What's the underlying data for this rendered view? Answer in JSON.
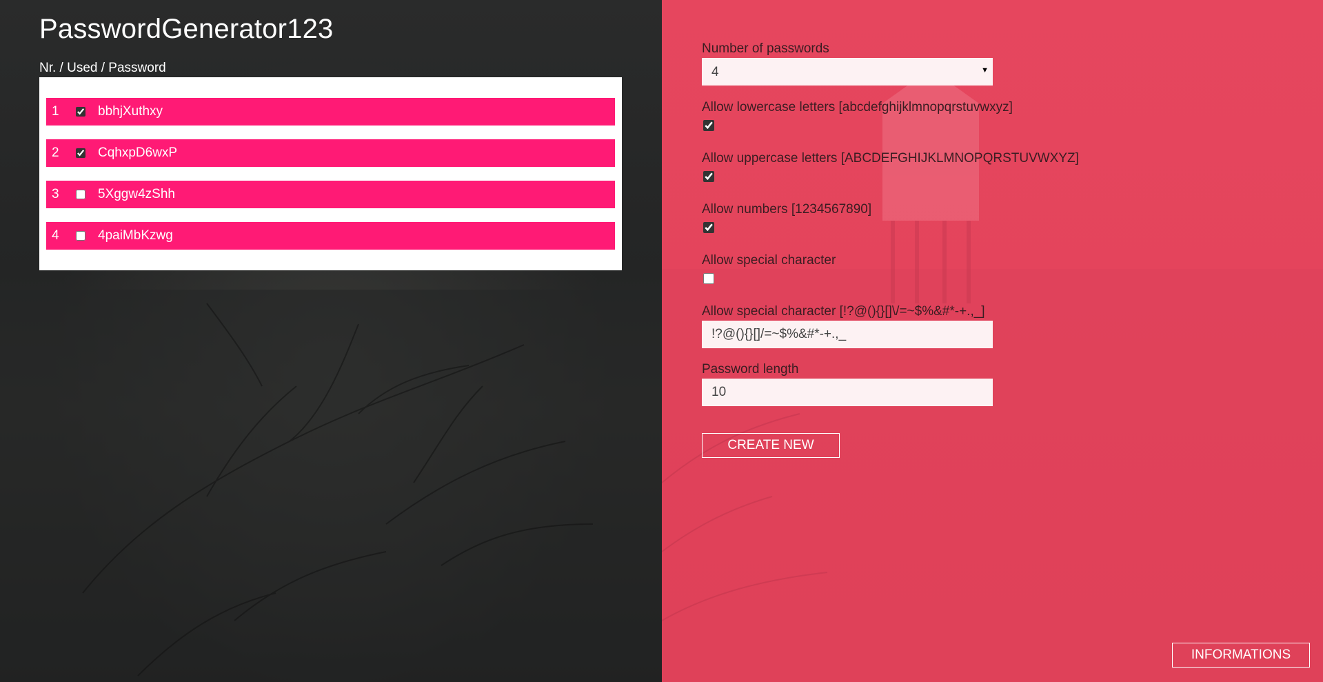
{
  "app": {
    "title": "PasswordGenerator123",
    "list_header": "Nr. / Used / Password"
  },
  "passwords": [
    {
      "nr": "1",
      "used": true,
      "password": "bbhjXuthxy"
    },
    {
      "nr": "2",
      "used": true,
      "password": "CqhxpD6wxP"
    },
    {
      "nr": "3",
      "used": false,
      "password": "5Xggw4zShh"
    },
    {
      "nr": "4",
      "used": false,
      "password": "4paiMbKzwg"
    }
  ],
  "settings": {
    "count_label": "Number of passwords",
    "count_value": "4",
    "lowercase_label": "Allow lowercase letters [abcdefghijklmnopqrstuvwxyz]",
    "lowercase_checked": true,
    "uppercase_label": "Allow uppercase letters [ABCDEFGHIJKLMNOPQRSTUVWXYZ]",
    "uppercase_checked": true,
    "numbers_label": "Allow numbers [1234567890]",
    "numbers_checked": true,
    "special_label": "Allow special character",
    "special_checked": false,
    "special_set_label": "Allow special character [!?@(){}[]\\/=~$%&#*-+.,_]",
    "special_set_value": "!?@(){}[]/=~$%&#*-+.,_",
    "length_label": "Password length",
    "length_value": "10"
  },
  "buttons": {
    "create": "CREATE NEW",
    "info": "INFORMATIONS"
  },
  "colors": {
    "left_panel": "#242525",
    "right_panel": "#e6465f",
    "row_highlight": "#ff1a75"
  }
}
